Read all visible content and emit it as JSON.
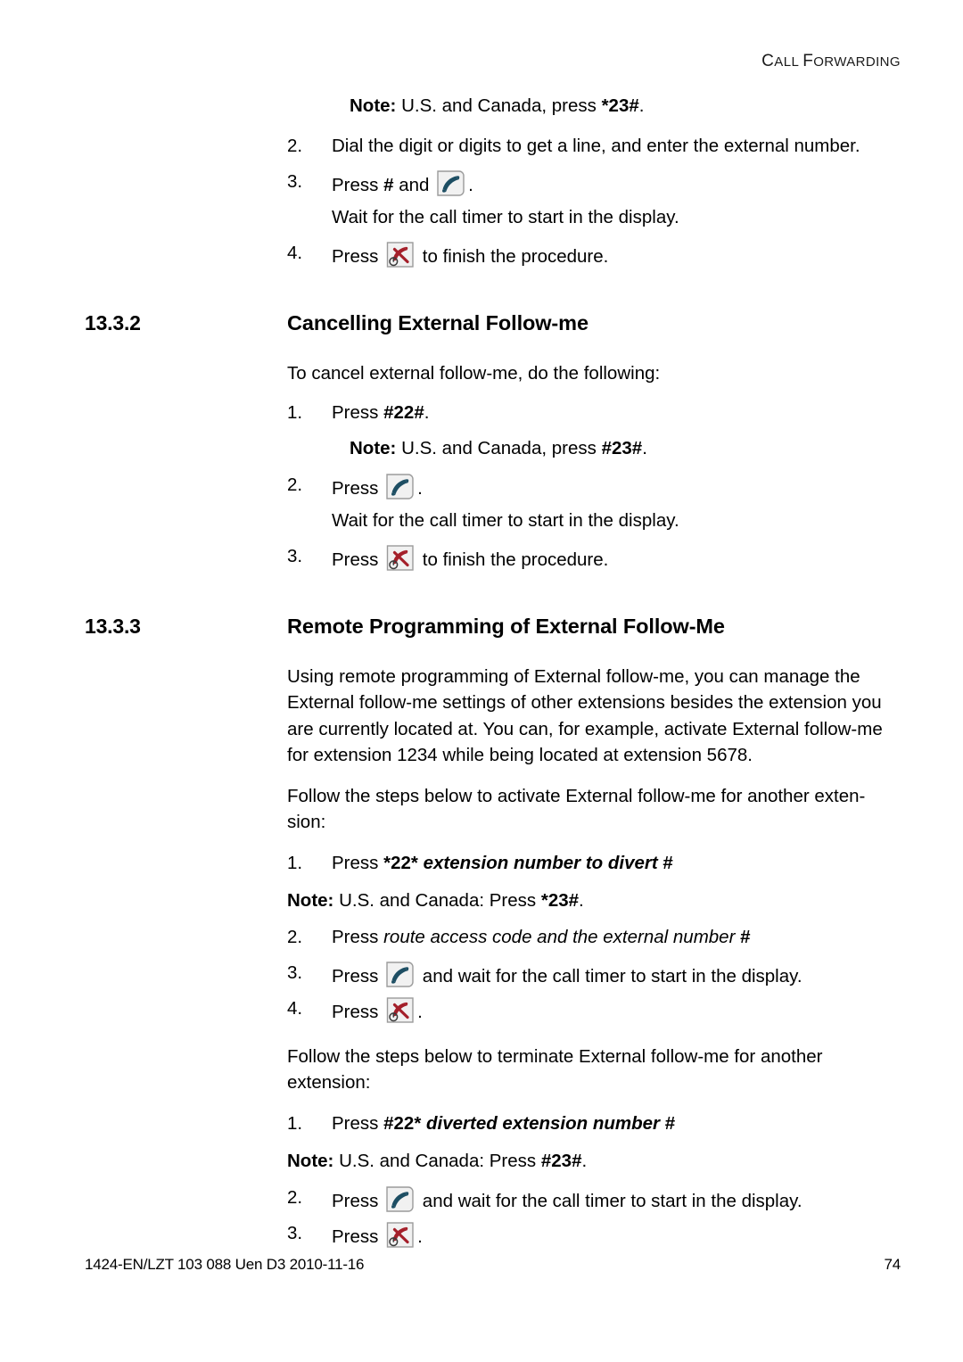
{
  "header": {
    "running_head": "CALL FORWARDING",
    "running_head_lead_c": "C",
    "running_head_rest_all": "ALL ",
    "running_head_lead_f": "F",
    "running_head_rest_forwarding": "ORWARDING"
  },
  "icons": {
    "answer_call": "answer-call-key-icon",
    "end_call": "end-call-key-icon",
    "answer_color": "#1d4e63",
    "end_color": "#a41f2a",
    "key_face": "#f2f2f2",
    "key_border": "#9a9a9a"
  },
  "top_section": {
    "note": {
      "label": "Note:",
      "text_plain": " U.S. and Canada, press ",
      "text_bold": "*23#",
      "text_end": "."
    },
    "steps": [
      {
        "num": "2.",
        "plain": "Dial the digit or digits to get a line, and enter the external number."
      },
      {
        "num": "3.",
        "pre": "Press ",
        "bold": "#",
        "mid": " and ",
        "icon": "answer_call",
        "post": "."
      },
      {
        "continuation": "Wait for the call timer to start in the display."
      },
      {
        "num": "4.",
        "pre": "Press ",
        "icon": "end_call",
        "post": " to finish the procedure."
      }
    ]
  },
  "section_1332": {
    "number": "13.3.2",
    "title": "Cancelling External Follow-me",
    "intro": "To cancel external follow-me, do the following:",
    "steps": [
      {
        "num": "1.",
        "pre": "Press ",
        "bold": "#22#",
        "post": "."
      },
      {
        "note": {
          "label": "Note:",
          "text_plain": " U.S. and Canada, press ",
          "text_bold": "#23#",
          "text_end": "."
        }
      },
      {
        "num": "2.",
        "pre": "Press ",
        "icon": "answer_call",
        "post": "."
      },
      {
        "continuation": "Wait for the call timer to start in the display."
      },
      {
        "num": "3.",
        "pre": "Press ",
        "icon": "end_call",
        "post": " to finish the procedure."
      }
    ]
  },
  "section_1333": {
    "number": "13.3.3",
    "title": "Remote Programming of External Follow-Me",
    "para1": "Using remote programming of External follow-me, you can manage the External follow-me settings of other extensions besides the extension you are currently located at. You can, for example, activate External follow-me for extension 1234 while being located at extension 5678.",
    "para2": "Follow the steps below to activate External follow-me for another exten-sion:",
    "activate_steps": [
      {
        "num": "1.",
        "pre": "Press ",
        "bold": "*22*",
        "bolditalic": " extension number to divert ",
        "bold_end": "#"
      },
      {
        "note_flush": {
          "label": "Note:",
          "text_plain": " U.S. and Canada: Press ",
          "text_bold": "*23#",
          "text_end": "."
        }
      },
      {
        "num": "2.",
        "pre": "Press ",
        "italic": "route access code and the external number ",
        "bold_end": "#"
      },
      {
        "num": "3.",
        "pre": "Press ",
        "icon": "answer_call",
        "post": " and wait for the call timer to start in the display."
      },
      {
        "num": "4.",
        "pre": "Press ",
        "icon": "end_call",
        "post": "."
      }
    ],
    "para3": "Follow the steps below to terminate External follow-me for another extension:",
    "terminate_steps": [
      {
        "num": "1.",
        "pre": "Press ",
        "bold": "#22*",
        "bolditalic": " diverted extension number ",
        "bold_end": "#"
      },
      {
        "note_flush": {
          "label": "Note:",
          "text_plain": " U.S. and Canada: Press ",
          "text_bold": "#23#",
          "text_end": "."
        }
      },
      {
        "num": "2.",
        "pre": "Press ",
        "icon": "answer_call",
        "post": " and wait for the call timer to start in the display."
      },
      {
        "num": "3.",
        "pre": "Press ",
        "icon": "end_call",
        "post": "."
      }
    ]
  },
  "footer": {
    "doc_id": "1424-EN/LZT 103 088 Uen D3 2010-11-16",
    "page_number": "74"
  }
}
